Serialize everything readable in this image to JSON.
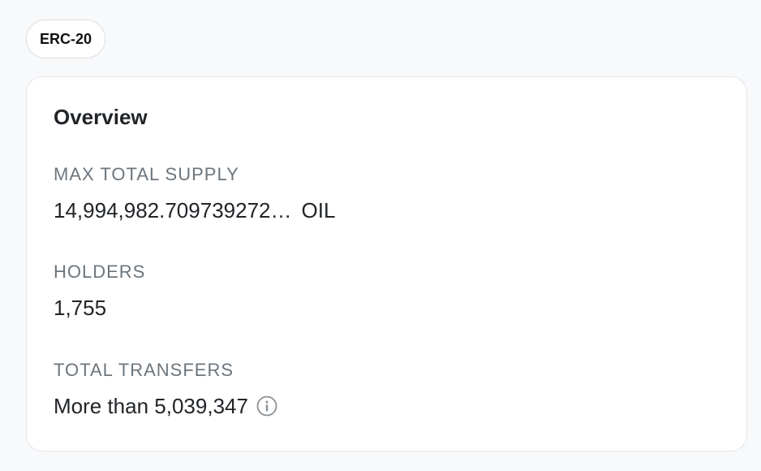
{
  "badge": {
    "label": "ERC-20"
  },
  "overview": {
    "title": "Overview",
    "max_total_supply": {
      "label": "MAX TOTAL SUPPLY",
      "value": "14,994,982.709739272…",
      "unit": "OIL"
    },
    "holders": {
      "label": "HOLDERS",
      "value": "1,755"
    },
    "total_transfers": {
      "label": "TOTAL TRANSFERS",
      "value": "More than 5,039,347",
      "icon": "info-icon"
    }
  },
  "colors": {
    "page_background": "#f8f9fa",
    "card_background": "#ffffff",
    "label_gray": "#6c757d",
    "text_dark": "#212529"
  }
}
